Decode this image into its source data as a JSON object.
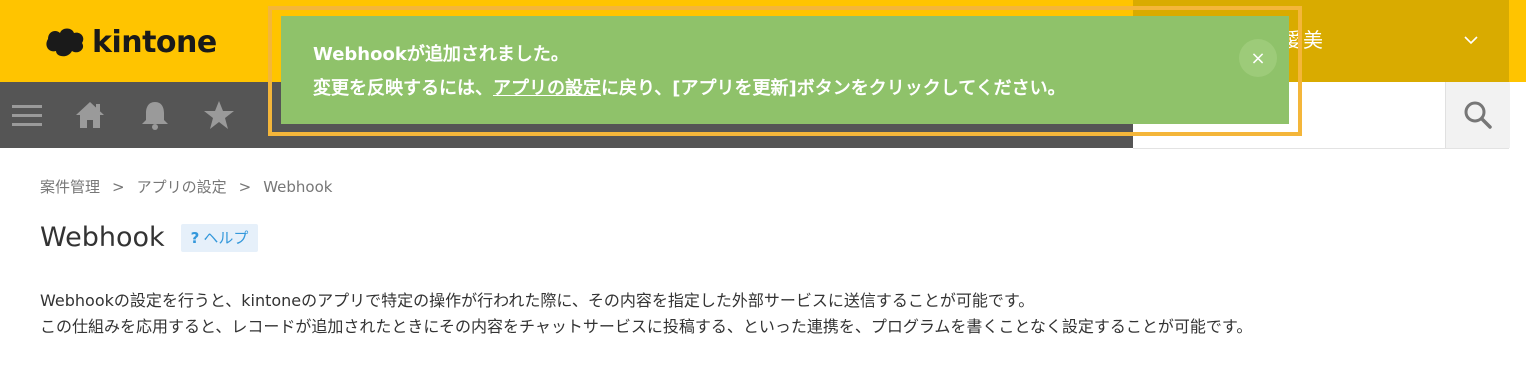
{
  "header": {
    "logo_text": "kintone",
    "user_name": "愛美",
    "search_placeholder": ""
  },
  "nav": {
    "icons": [
      "menu-icon",
      "home-icon",
      "bell-icon",
      "star-icon"
    ]
  },
  "notification": {
    "line1": "Webhookが追加されました。",
    "line2_before": "変更を反映するには、",
    "line2_link": "アプリの設定",
    "line2_after": "に戻り、[アプリを更新]ボタンをクリックしてください。",
    "close_label": "×"
  },
  "breadcrumb": {
    "items": [
      "案件管理",
      "アプリの設定",
      "Webhook"
    ],
    "separator": ">"
  },
  "page": {
    "title": "Webhook",
    "help_q": "?",
    "help_label": "ヘルプ",
    "desc_line1": "Webhookの設定を行うと、kintoneのアプリで特定の操作が行われた際に、その内容を指定した外部サービスに送信することが可能です。",
    "desc_line2": "この仕組みを応用すると、レコードが追加されたときにその内容をチャットサービスに投稿する、といった連携を、プログラムを書くことなく設定することが可能です。"
  },
  "colors": {
    "header_yellow": "#ffc400",
    "user_area": "#d9ab00",
    "navbar": "#555555",
    "notification_green": "#8fc26a",
    "highlight_border": "#f4b63a",
    "help_blue": "#3498db"
  }
}
